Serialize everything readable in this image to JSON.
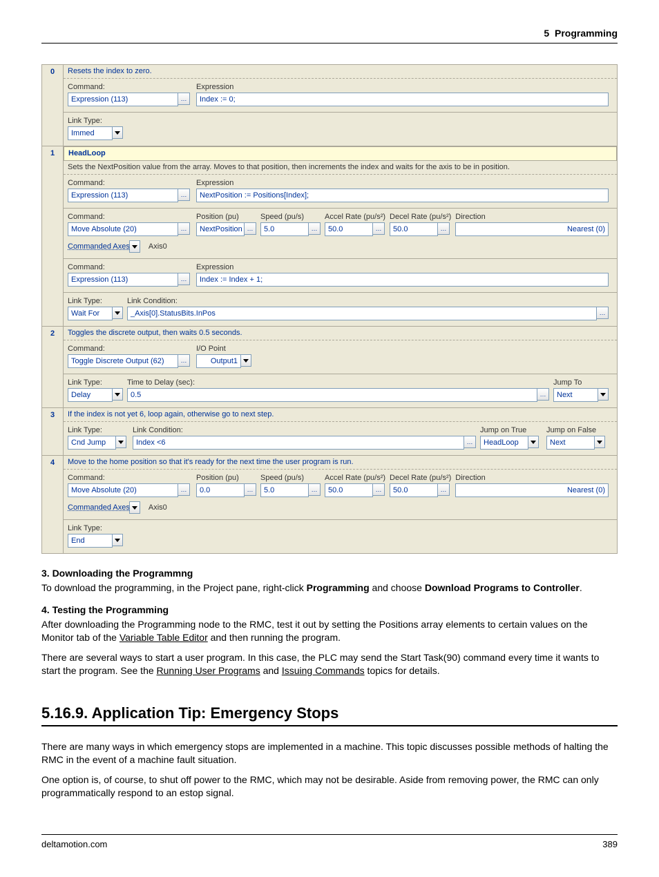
{
  "header": {
    "chapter": "5",
    "title": "Programming"
  },
  "steps": [
    {
      "num": "0",
      "desc": "Resets the index to zero.",
      "blocks": [
        {
          "type": "cmd_expr",
          "command_label": "Command:",
          "command_value": "Expression (113)",
          "expr_label": "Expression",
          "expr_value": "Index := 0;"
        },
        {
          "type": "link",
          "link_label": "Link Type:",
          "link_value": "Immed"
        }
      ]
    },
    {
      "num": "1",
      "title": "HeadLoop",
      "desc": "Sets the NextPosition value from the array. Moves to that position, then increments the index and waits for the axis to be in position.",
      "blocks": [
        {
          "type": "cmd_expr",
          "command_label": "Command:",
          "command_value": "Expression (113)",
          "expr_label": "Expression",
          "expr_value": "NextPosition := Positions[Index];"
        },
        {
          "type": "move",
          "command_label": "Command:",
          "command_value": "Move Absolute (20)",
          "cols": [
            {
              "label": "Position (pu)",
              "value": "NextPosition"
            },
            {
              "label": "Speed (pu/s)",
              "value": "5.0"
            },
            {
              "label": "Accel Rate (pu/s²)",
              "value": "50.0"
            },
            {
              "label": "Decel Rate (pu/s²)",
              "value": "50.0"
            },
            {
              "label": "Direction",
              "value": "Nearest (0)"
            }
          ],
          "axes_label": "Commanded Axes",
          "axes_value": "Axis0"
        },
        {
          "type": "cmd_expr",
          "command_label": "Command:",
          "command_value": "Expression (113)",
          "expr_label": "Expression",
          "expr_value": "Index := Index + 1;"
        },
        {
          "type": "link_cond",
          "link_label": "Link Type:",
          "link_value": "Wait For",
          "cond_label": "Link Condition:",
          "cond_value": "_Axis[0].StatusBits.InPos"
        }
      ]
    },
    {
      "num": "2",
      "desc": "Toggles the discrete output, then waits 0.5 seconds.",
      "blocks": [
        {
          "type": "cmd_io",
          "command_label": "Command:",
          "command_value": "Toggle Discrete Output (62)",
          "io_label": "I/O Point",
          "io_value": "Output1"
        },
        {
          "type": "link_delay",
          "link_label": "Link Type:",
          "link_value": "Delay",
          "delay_label": "Time to Delay (sec):",
          "delay_value": "0.5",
          "jump_label": "Jump To",
          "jump_value": "Next"
        }
      ]
    },
    {
      "num": "3",
      "desc": "If the index is not yet 6, loop again, otherwise go to next step.",
      "blocks": [
        {
          "type": "link_cndjump",
          "link_label": "Link Type:",
          "link_value": "Cnd Jump",
          "cond_label": "Link Condition:",
          "cond_value": "Index <6",
          "true_label": "Jump on True",
          "true_value": "HeadLoop",
          "false_label": "Jump on False",
          "false_value": "Next"
        }
      ]
    },
    {
      "num": "4",
      "desc": "Move to the home position so that it's ready for the next time the user program is run.",
      "blocks": [
        {
          "type": "move",
          "command_label": "Command:",
          "command_value": "Move Absolute (20)",
          "cols": [
            {
              "label": "Position (pu)",
              "value": "0.0"
            },
            {
              "label": "Speed (pu/s)",
              "value": "5.0"
            },
            {
              "label": "Accel Rate (pu/s²)",
              "value": "50.0"
            },
            {
              "label": "Decel Rate (pu/s²)",
              "value": "50.0"
            },
            {
              "label": "Direction",
              "value": "Nearest (0)"
            }
          ],
          "axes_label": "Commanded Axes",
          "axes_value": "Axis0"
        },
        {
          "type": "link",
          "link_label": "Link Type:",
          "link_value": "End"
        }
      ]
    }
  ],
  "text": {
    "sub3_title": "3. Downloading the Programmng",
    "sub3_p1a": "To download the programming, in the Project pane, right-click ",
    "sub3_p1b": "Programming",
    "sub3_p1c": " and choose ",
    "sub3_p1d": "Download Programs to Controller",
    "sub3_p1e": ".",
    "sub4_title": "4. Testing the Programming",
    "sub4_p1a": "After downloading the Programming node to the RMC, test it out by setting the Positions array elements to certain values on the Monitor tab of the ",
    "sub4_p1b": "Variable Table Editor",
    "sub4_p1c": " and then running the program.",
    "sub4_p2a": "There are several ways to start a user program. In this case, the PLC may send the Start Task(90) command every time it wants to start the program. See the ",
    "sub4_p2b": "Running User Programs",
    "sub4_p2c": " and ",
    "sub4_p2d": "Issuing Commands",
    "sub4_p2e": " topics for details.",
    "section_h1": "5.16.9. Application Tip: Emergency Stops",
    "sec_p1": "There are many ways in which emergency stops are implemented in a machine. This topic discusses possible methods of halting the RMC in the event of a machine fault situation.",
    "sec_p2": "One option is, of course, to shut off power to the RMC, which may not be desirable. Aside from removing power, the RMC can only programmatically respond to an estop signal."
  },
  "footer": {
    "left": "deltamotion.com",
    "right": "389"
  }
}
